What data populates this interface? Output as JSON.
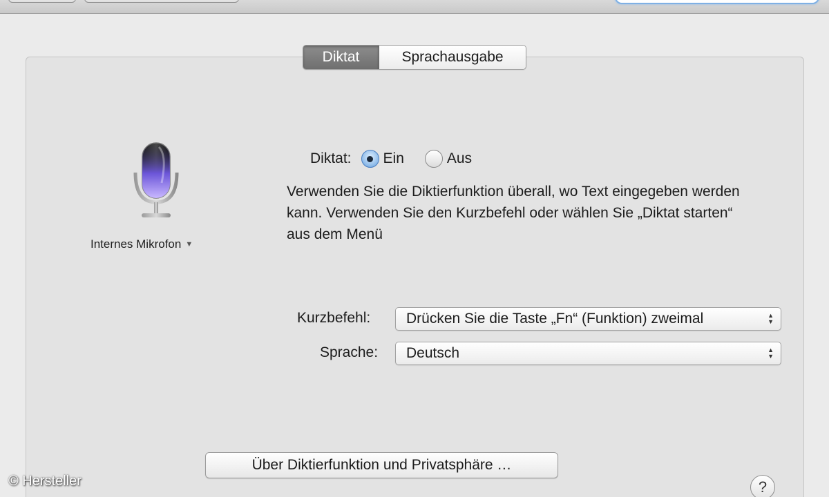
{
  "tabs": [
    {
      "label": "Diktat",
      "active": true
    },
    {
      "label": "Sprachausgabe",
      "active": false
    }
  ],
  "microphone": {
    "label": "Internes Mikrofon",
    "caret": "▼"
  },
  "dictation": {
    "label": "Diktat:",
    "option_on": "Ein",
    "option_off": "Aus",
    "selected": "Ein",
    "description": "Verwenden Sie die Diktierfunktion überall, wo Text eingegeben werden kann. Verwenden Sie den Kurzbefehl oder wählen Sie „Diktat starten“ aus dem Menü"
  },
  "shortcut": {
    "label": "Kurzbefehl:",
    "value": "Drücken Sie die Taste „Fn“ (Funktion) zweimal"
  },
  "language": {
    "label": "Sprache:",
    "value": "Deutsch"
  },
  "about_button": "Über Diktierfunktion und Privatsphäre …",
  "help_button": "?",
  "credit": "© Hersteller",
  "colors": {
    "accent": "#6d9fd8",
    "active_tab": "#7a7a7a",
    "mic_glow": "#9a7bff"
  },
  "icons": {
    "microphone": "microphone-icon",
    "popup_arrows": "up-down-arrows-icon",
    "help": "question-mark-icon"
  }
}
